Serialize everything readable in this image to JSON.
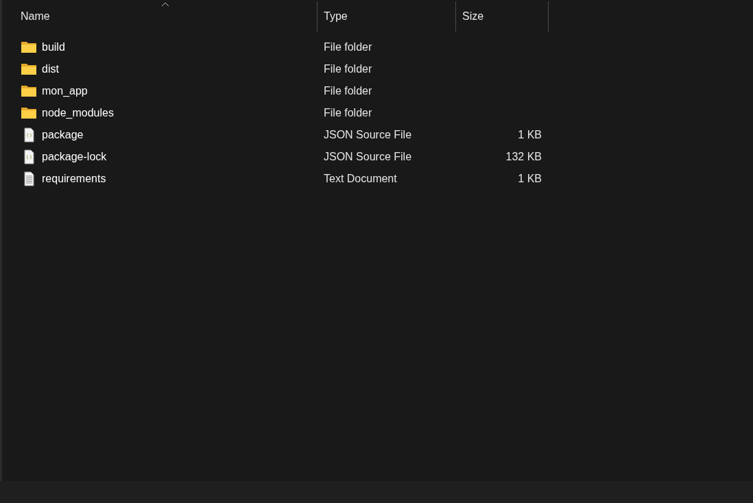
{
  "columns": [
    {
      "label": "Name",
      "sorted": true
    },
    {
      "label": "Type",
      "sorted": false
    },
    {
      "label": "Size",
      "sorted": false
    }
  ],
  "rows": [
    {
      "kind": "folder",
      "name": "build",
      "type": "File folder"
    },
    {
      "kind": "folder",
      "name": "dist",
      "type": "File folder"
    },
    {
      "kind": "folder",
      "name": "mon_app",
      "type": "File folder"
    },
    {
      "kind": "folder",
      "name": "node_modules",
      "type": "File folder"
    },
    {
      "kind": "json",
      "name": "package",
      "type": "JSON Source File",
      "size": "1 KB"
    },
    {
      "kind": "json",
      "name": "package-lock",
      "type": "JSON Source File",
      "size": "132 KB"
    },
    {
      "kind": "text",
      "name": "requirements",
      "type": "Text Document",
      "size": "1 KB"
    }
  ]
}
